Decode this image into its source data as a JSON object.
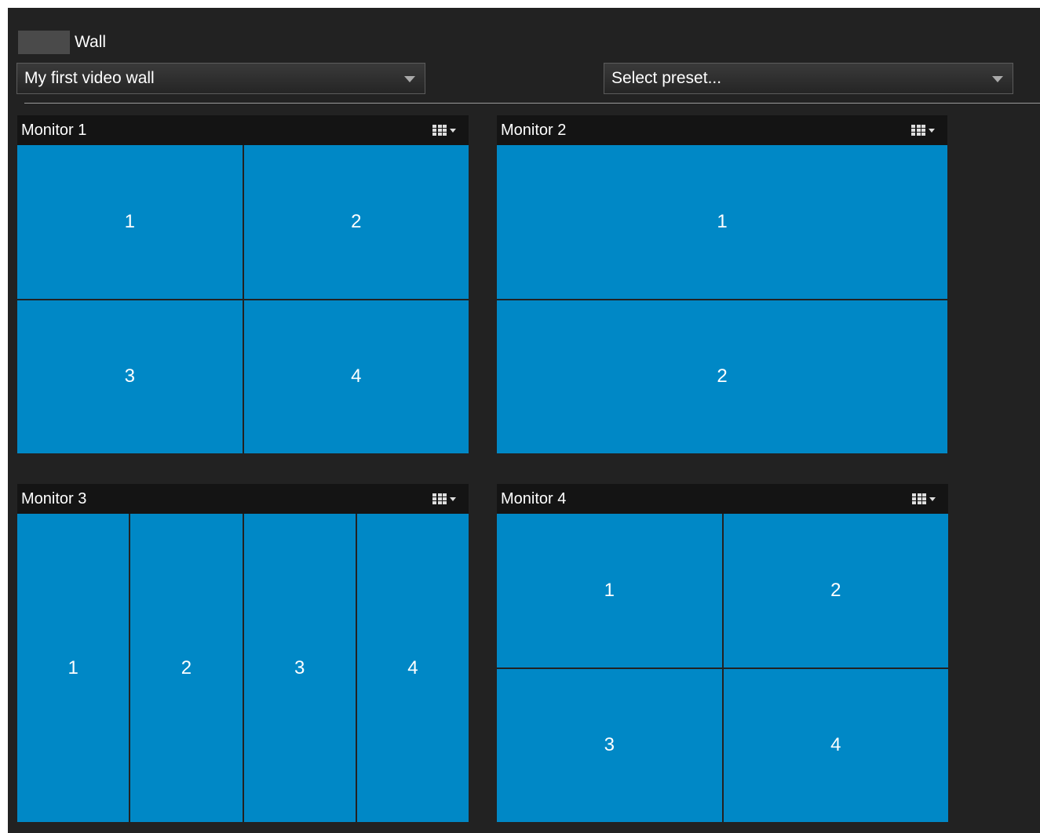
{
  "header": {
    "wall_label": "Wall"
  },
  "wall_select": {
    "value": "My first video wall"
  },
  "preset_select": {
    "value": "Select preset..."
  },
  "icons": {
    "layout": "grid-layout-icon",
    "dropdown": "chevron-down-icon"
  },
  "colors": {
    "background": "#222222",
    "header_bar": "#141414",
    "cell": "#0088c6"
  },
  "monitors": [
    {
      "title": "Monitor 1",
      "layout": "2x2",
      "cells": [
        "1",
        "2",
        "3",
        "4"
      ]
    },
    {
      "title": "Monitor 2",
      "layout": "1x2",
      "cells": [
        "1",
        "2"
      ]
    },
    {
      "title": "Monitor 3",
      "layout": "4x1",
      "cells": [
        "1",
        "2",
        "3",
        "4"
      ]
    },
    {
      "title": "Monitor 4",
      "layout": "2x2",
      "cells": [
        "1",
        "2",
        "3",
        "4"
      ]
    }
  ]
}
